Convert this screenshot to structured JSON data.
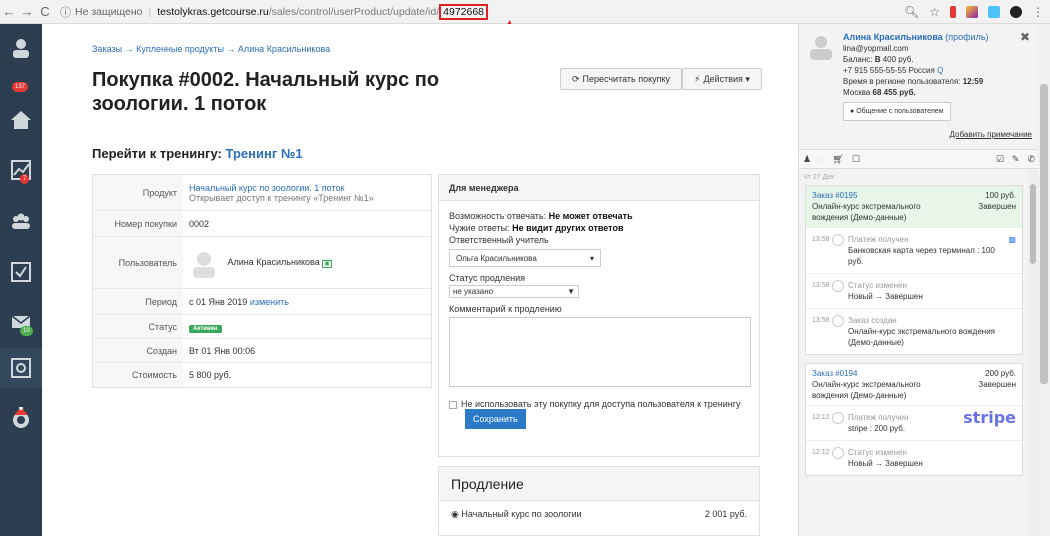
{
  "browser": {
    "back": "←",
    "forward": "→",
    "reload": "C",
    "insecure_label": "Не защищено",
    "host": "testolykras.getcourse.ru",
    "path": "/sales/control/userProduct/update/id/",
    "highlighted_id": "4972668"
  },
  "sidebar": {
    "badges": {
      "notifications": "137",
      "stats": "7",
      "mail": "10"
    },
    "colors": {
      "bg": "#2c3e50",
      "badge": "#e53935"
    }
  },
  "main": {
    "breadcrumb": "Заказы → Купленные продукты → Алина Красильникова",
    "title": "Покупка #0002. Начальный курс по зоологии. 1 поток",
    "recalc_label": "Пересчитать покупку",
    "actions_label": "Действия ▾",
    "goto_label": "Перейти к тренингу:",
    "goto_link": "Тренинг №1"
  },
  "info": {
    "product_key": "Продукт",
    "product_link": "Начальный курс по зоологии. 1 поток",
    "product_desc": "Открывает доступ к тренингу «Тренинг №1»",
    "number_key": "Номер покупки",
    "number_val": "0002",
    "user_key": "Пользователь",
    "user_val": "Алина Красильникова",
    "period_key": "Период",
    "period_val": "с 01 Янв 2019",
    "period_change": "изменить",
    "status_key": "Статус",
    "status_val": "Активен",
    "created_key": "Создан",
    "created_val": "Вт 01 Янв 00:06",
    "cost_key": "Стоимость",
    "cost_val": "5 800 руб."
  },
  "manager": {
    "head": "Для менеджера",
    "reply_label": "Возможность отвечать:",
    "reply_val": "Не может отвечать",
    "others_label": "Чужие ответы:",
    "others_val": "Не видит других ответов",
    "teacher_label": "Ответственный учитель",
    "teacher_val": "Ольга Красильникова",
    "renew_status_label": "Статус продления",
    "renew_status_val": "не указано",
    "comment_label": "Комментарий к продлению",
    "checkbox_label": "Не использовать эту покупку для доступа пользователя к тренингу",
    "save_label": "Сохранить"
  },
  "renew": {
    "head": "Продление",
    "item": "Начальный курс по зоологии",
    "price": "2 001 руб."
  },
  "right": {
    "name": "Алина Красильникова",
    "profile": "(профиль)",
    "email": "lina@yopmail.com",
    "balance_label": "Баланс:",
    "balance_val": "400 руб.",
    "phone": "+7 915 555-55-55 Россия",
    "time_label": "Время в регионе пользователя:",
    "time_val": "12:59",
    "city": "Москва",
    "city_val": "68 455 руб.",
    "chat_btn": "Общение с пользователем",
    "add_note": "Добавить примечание",
    "date": "Чт 27 Дек",
    "orders": [
      {
        "title": "Заказ #0195",
        "price": "100 руб.",
        "name": "Онлайн-курс экстремального вождения (Демо-данные)",
        "status": "Завершен",
        "events": [
          {
            "time": "13:58",
            "title": "Платеж получен",
            "text": "Банковская карта через терминал : 100 руб."
          },
          {
            "time": "13:58",
            "title": "Статус изменен",
            "text": "Новый → Завершен"
          },
          {
            "time": "13:56",
            "title": "Заказ создан",
            "text": "Онлайн-курс экстремального вождения (Демо-данные)"
          }
        ]
      },
      {
        "title": "Заказ #0194",
        "price": "200 руб.",
        "name": "Онлайн-курс экстремального вождения (Демо-данные)",
        "status": "Завершен",
        "events": [
          {
            "time": "12:12",
            "title": "Платеж получен",
            "text": "stripe : 200 руб.",
            "logo": "stripe"
          },
          {
            "time": "12:12",
            "title": "Статус изменен",
            "text": "Новый → Завершен"
          }
        ]
      }
    ]
  }
}
